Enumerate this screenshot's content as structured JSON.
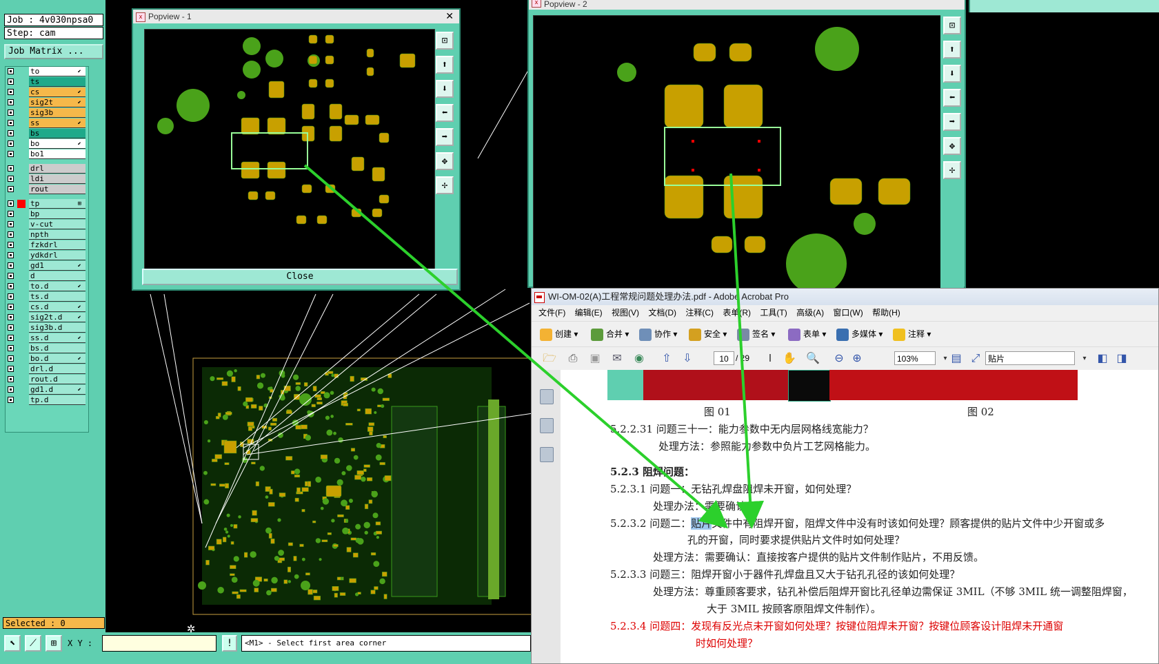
{
  "cam": {
    "job": "Job : 4v030npsa0",
    "step": "Step: cam",
    "job_matrix": "Job Matrix ...",
    "selected": "Selected : 0",
    "xy_label": "X Y :",
    "bang": "!",
    "status": "<M1> - Select first area corner",
    "layers": [
      {
        "name": "to",
        "color": "#ffffff",
        "mark": "⬋"
      },
      {
        "name": "ts",
        "color": "#1fa98a",
        "mark": ""
      },
      {
        "name": "cs",
        "color": "#f5b84a",
        "mark": "⬋"
      },
      {
        "name": "sig2t",
        "color": "#f5b84a",
        "mark": "⬋"
      },
      {
        "name": "sig3b",
        "color": "#f5b84a",
        "mark": ""
      },
      {
        "name": "ss",
        "color": "#f5b84a",
        "mark": "⬋"
      },
      {
        "name": "bs",
        "color": "#1fa98a",
        "mark": ""
      },
      {
        "name": "bo",
        "color": "#ffffff",
        "mark": "⬋"
      },
      {
        "name": "bo1",
        "color": "#ffffff",
        "mark": ""
      },
      {
        "name": "drl",
        "color": "#cccccc",
        "mark": ""
      },
      {
        "name": "ldi",
        "color": "#cccccc",
        "mark": ""
      },
      {
        "name": "rout",
        "color": "#cccccc",
        "mark": ""
      },
      {
        "name": "tp",
        "color": "#9ee8d4",
        "mark": "⊞"
      },
      {
        "name": "bp",
        "color": "#9ee8d4",
        "mark": ""
      },
      {
        "name": "v-cut",
        "color": "#9ee8d4",
        "mark": ""
      },
      {
        "name": "npth",
        "color": "#9ee8d4",
        "mark": ""
      },
      {
        "name": "fzkdrl",
        "color": "#9ee8d4",
        "mark": ""
      },
      {
        "name": "ydkdrl",
        "color": "#9ee8d4",
        "mark": ""
      },
      {
        "name": "gd1",
        "color": "#9ee8d4",
        "mark": "⬋"
      },
      {
        "name": "d",
        "color": "#9ee8d4",
        "mark": ""
      },
      {
        "name": "to.d",
        "color": "#9ee8d4",
        "mark": "⬋"
      },
      {
        "name": "ts.d",
        "color": "#9ee8d4",
        "mark": ""
      },
      {
        "name": "cs.d",
        "color": "#9ee8d4",
        "mark": "⬋"
      },
      {
        "name": "sig2t.d",
        "color": "#9ee8d4",
        "mark": "⬋"
      },
      {
        "name": "sig3b.d",
        "color": "#9ee8d4",
        "mark": ""
      },
      {
        "name": "ss.d",
        "color": "#9ee8d4",
        "mark": "⬋"
      },
      {
        "name": "bs.d",
        "color": "#9ee8d4",
        "mark": ""
      },
      {
        "name": "bo.d",
        "color": "#9ee8d4",
        "mark": "⬋"
      },
      {
        "name": "drl.d",
        "color": "#9ee8d4",
        "mark": ""
      },
      {
        "name": "rout.d",
        "color": "#9ee8d4",
        "mark": ""
      },
      {
        "name": "gd1.d",
        "color": "#9ee8d4",
        "mark": "⬋"
      },
      {
        "name": "tp.d",
        "color": "#9ee8d4",
        "mark": ""
      }
    ]
  },
  "popview1": {
    "title": "Popview - 1",
    "close": "✕",
    "close_button": "Close"
  },
  "popview2": {
    "title": "Popview - 2"
  },
  "acrobat": {
    "title": "WI-OM-02(A)工程常规问题处理办法.pdf - Adobe Acrobat Pro",
    "menu": [
      "文件(F)",
      "编辑(E)",
      "视图(V)",
      "文档(D)",
      "注释(C)",
      "表单(R)",
      "工具(T)",
      "高级(A)",
      "窗口(W)",
      "帮助(H)"
    ],
    "toolbar": [
      "创建 ▾",
      "合并 ▾",
      "协作 ▾",
      "安全 ▾",
      "签名 ▾",
      "表单 ▾",
      "多媒体 ▾",
      "注释 ▾"
    ],
    "page_current": "10",
    "page_total": "/ 29",
    "zoom": "103%",
    "find": "贴片",
    "captions": [
      "图 01",
      "图 02"
    ],
    "lines": {
      "l1": "5.2.2.31 问题三十一：能力参数中无内层网格线宽能力？",
      "l2": "处理方法：参照能力参数中负片工艺网格能力。",
      "l3": "5.2.3 阻焊问题：",
      "l4": "5.2.3.1 问题一：无钻孔焊盘阻焊未开窗，如何处理？",
      "l5": "处理办法：需要确认。",
      "l6_pre": "5.2.3.2 问题二：",
      "l6_hl": "贴片",
      "l6_post": "文件中有阻焊开窗，阻焊文件中没有时该如何处理？顾客提供的贴片文件中少开窗或多",
      "l7": "孔的开窗，同时要求提供贴片文件时如何处理？",
      "l8": "处理方法：需要确认：直接按客户提供的贴片文件制作贴片，不用反馈。",
      "l9": "5.2.3.3 问题三：阻焊开窗小于器件孔焊盘且又大于钻孔孔径的该如何处理？",
      "l10": "处理方法：尊重顾客要求，钻孔补偿后阻焊开窗比孔径单边需保证 3MIL（不够 3MIL 统一调整阻焊窗，",
      "l11": "大于 3MIL 按顾客原阻焊文件制作）。",
      "l12": "5.2.3.4 问题四：发现有反光点未开窗如何处理？按键位阻焊未开窗？按键位顾客设计阻焊未开通窗",
      "l13": "时如何处理？"
    }
  }
}
